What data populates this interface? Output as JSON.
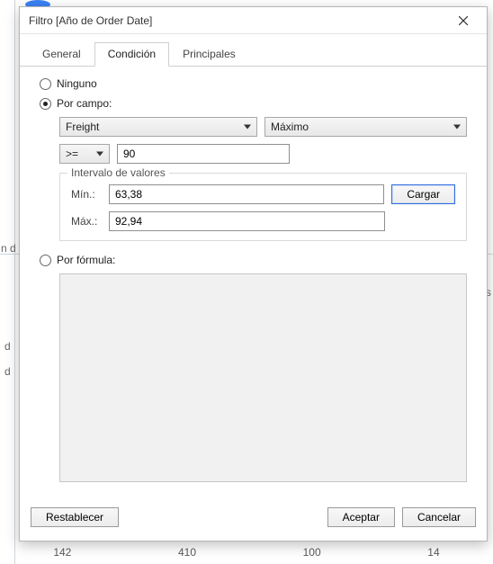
{
  "dialog": {
    "title": "Filtro [Año de Order Date]"
  },
  "tabs": {
    "general": "General",
    "condicion": "Condición",
    "principales": "Principales",
    "active": "condicion"
  },
  "options": {
    "none_label": "Ninguno",
    "byfield_label": "Por campo:",
    "byformula_label": "Por fórmula:",
    "field": "Freight",
    "aggregation": "Máximo",
    "operator": ">=",
    "value": "90"
  },
  "range": {
    "legend": "Intervalo de valores",
    "min_label": "Mín.:",
    "max_label": "Máx.:",
    "min": "63,38",
    "max": "92,94",
    "load_label": "Cargar"
  },
  "footer": {
    "reset": "Restablecer",
    "ok": "Aceptar",
    "cancel": "Cancelar"
  },
  "background": {
    "left1": "n d",
    "left2": "d",
    "left3": "d",
    "right1": "s",
    "numbers": [
      "142",
      "410",
      "100",
      "14"
    ]
  }
}
